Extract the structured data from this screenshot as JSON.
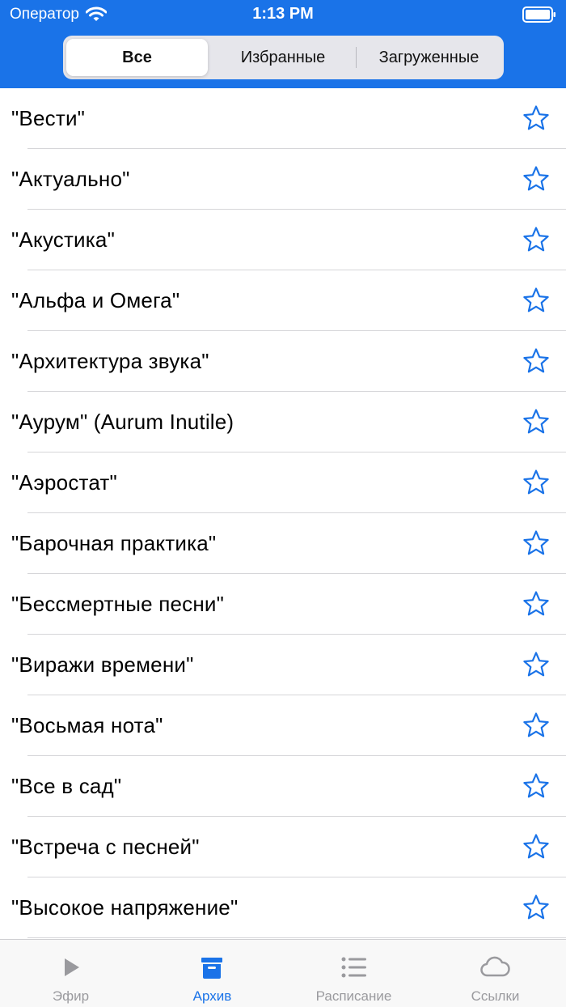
{
  "status_bar": {
    "carrier": "Оператор",
    "time": "1:13 PM"
  },
  "segments": [
    {
      "label": "Все",
      "active": true
    },
    {
      "label": "Избранные",
      "active": false
    },
    {
      "label": "Загруженные",
      "active": false
    }
  ],
  "programs": [
    "\"Вести\"",
    "\"Актуально\"",
    "\"Акустика\"",
    "\"Альфа и Омега\"",
    "\"Архитектура звука\"",
    "\"Аурум\" (Aurum Inutile)",
    "\"Аэростат\"",
    "\"Барочная практика\"",
    "\"Бессмертные песни\"",
    "\"Виражи времени\"",
    "\"Восьмая нота\"",
    "\"Все в сад\"",
    "\"Встреча с песней\"",
    "\"Высокое напряжение\""
  ],
  "tabs": [
    {
      "label": "Эфир",
      "icon": "play-icon",
      "active": false
    },
    {
      "label": "Архив",
      "icon": "archive-box-icon",
      "active": true
    },
    {
      "label": "Расписание",
      "icon": "list-icon",
      "active": false
    },
    {
      "label": "Ссылки",
      "icon": "cloud-icon",
      "active": false
    }
  ],
  "colors": {
    "accent": "#1a73e8",
    "inactive_tab": "#9a9a9e",
    "star": "#1a73e8"
  }
}
